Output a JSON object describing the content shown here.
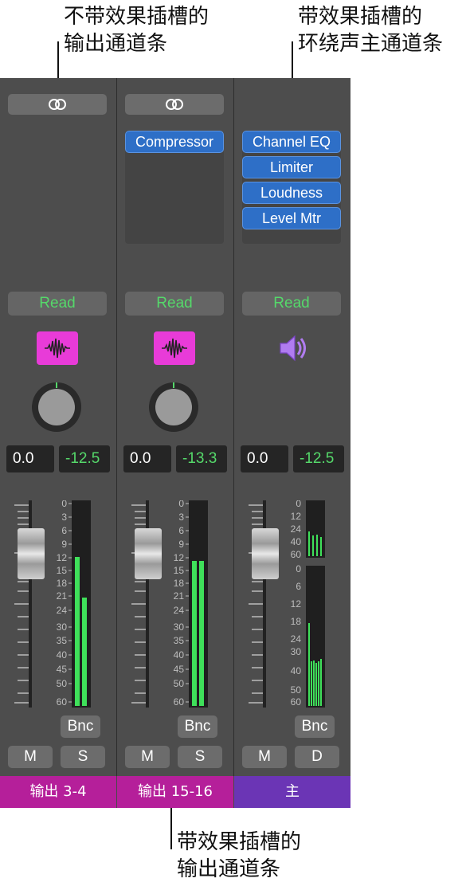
{
  "callouts": {
    "top_left": "不带效果插槽的\n输出通道条",
    "top_right": "带效果插槽的\n环绕声主通道条",
    "bottom": "带效果插槽的\n输出通道条"
  },
  "colors": {
    "strip_bg": "#4d4d4d",
    "plugin_blue": "#2e6fc7",
    "read_green": "#55d86a",
    "meter_green": "#3fe05a",
    "output_magenta": "#b51f9a",
    "master_purple": "#6b35b5"
  },
  "strips": [
    {
      "link_icon": "stereo-link-icon",
      "plugins": [],
      "automation": "Read",
      "icon": "waveform-icon",
      "volume": "0.0",
      "pan": "-12.5",
      "bounce": "Bnc",
      "mute": "M",
      "second_button": "S",
      "name": "输出 3-4",
      "meter_levels": [
        0.73,
        0.53
      ]
    },
    {
      "link_icon": "stereo-link-icon",
      "plugins": [
        "Compressor"
      ],
      "automation": "Read",
      "icon": "waveform-icon",
      "volume": "0.0",
      "pan": "-13.3",
      "bounce": "Bnc",
      "mute": "M",
      "second_button": "S",
      "name": "输出 15-16",
      "meter_levels": [
        0.71,
        0.71
      ]
    },
    {
      "link_icon": "",
      "plugins": [
        "Channel EQ",
        "Limiter",
        "Loudness",
        "Level Mtr"
      ],
      "automation": "Read",
      "icon": "speaker-icon",
      "volume": "0.0",
      "pan": "-12.5",
      "bounce": "Bnc",
      "mute": "M",
      "second_button": "D",
      "name": "主",
      "meter_levels": [
        0.46,
        0.38,
        0.32,
        0.33,
        0.31,
        0.32,
        0.34,
        0.6,
        0.4,
        0.35
      ]
    }
  ],
  "scale_labels": [
    "0",
    "3",
    "6",
    "9",
    "12",
    "15",
    "18",
    "21",
    "24",
    "30",
    "35",
    "40",
    "45",
    "50",
    "60"
  ],
  "surround_scale_top": [
    "0",
    "12",
    "24",
    "40",
    "60"
  ],
  "surround_scale_bottom": [
    "0",
    "6",
    "12",
    "18",
    "24",
    "30",
    "40",
    "50",
    "60"
  ]
}
